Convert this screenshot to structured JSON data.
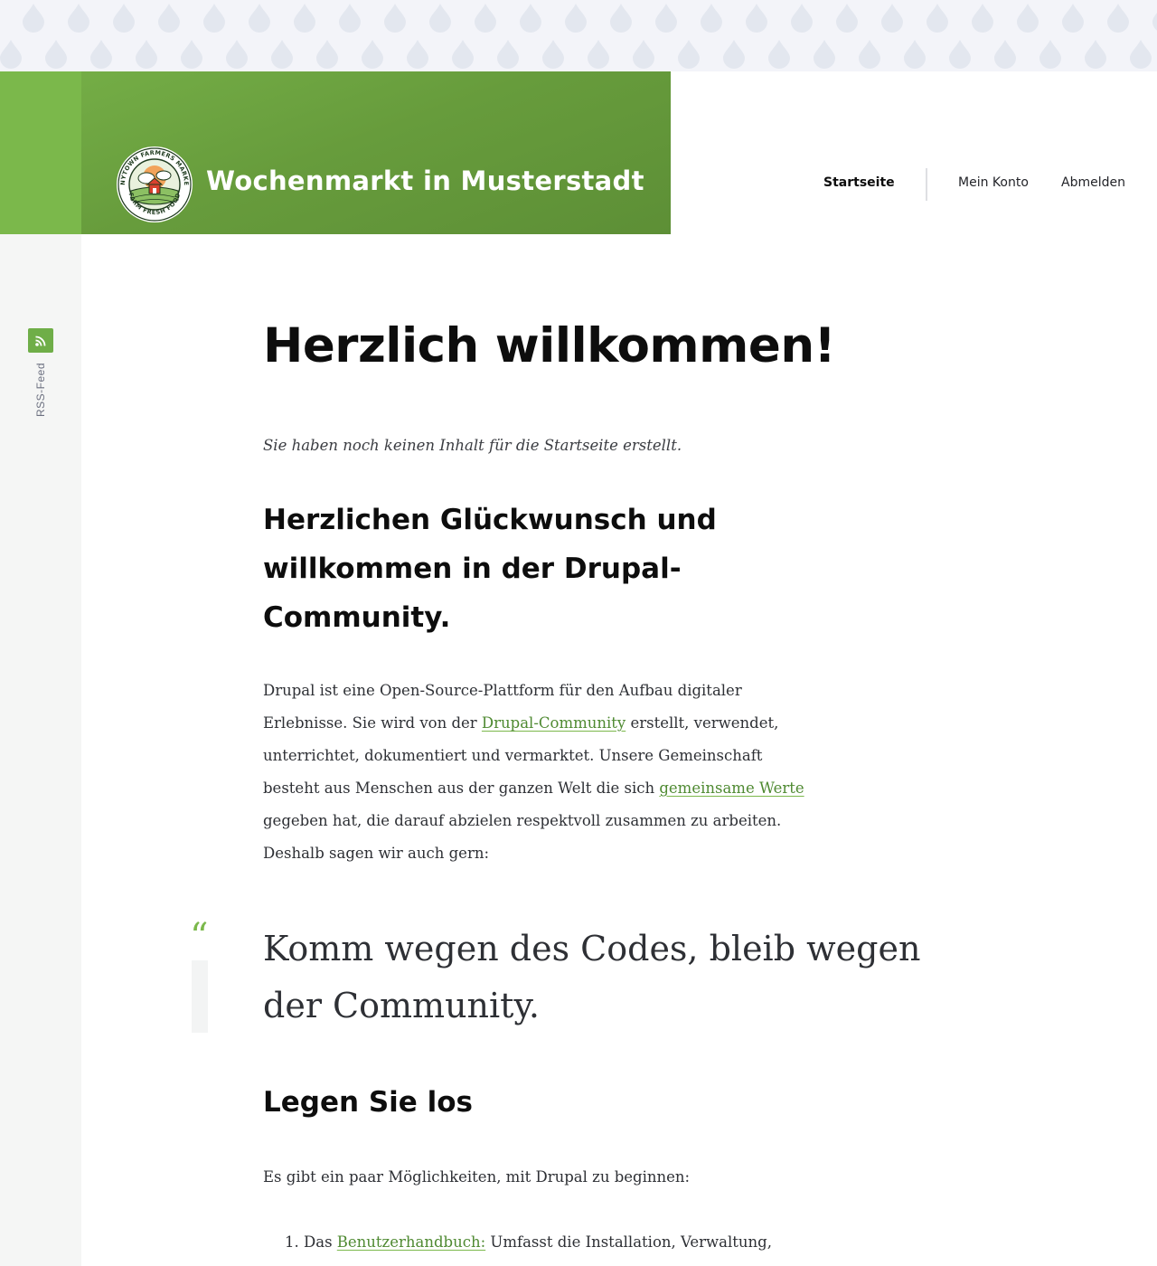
{
  "site": {
    "name": "Wochenmarkt in Musterstadt",
    "logo_name": "anytown-farmers-market-logo",
    "logo_text_top": "ANYTOWN FARMERS MARKET",
    "logo_text_bottom": "FARM FRESH FOOD"
  },
  "nav": {
    "items": [
      {
        "label": "Startseite",
        "active": true
      },
      {
        "label": "Mein Konto",
        "active": false
      },
      {
        "label": "Abmelden",
        "active": false
      }
    ]
  },
  "social": {
    "rss_label": "RSS-Feed",
    "rss_icon": "rss-icon"
  },
  "main": {
    "title": "Herzlich willkommen!",
    "empty_note": "Sie haben noch keinen Inhalt für die Startseite erstellt.",
    "congrats_heading": "Herzlichen Glückwunsch und willkommen in der Drupal-Community.",
    "intro": {
      "part1": "Drupal ist eine Open-Source-Plattform für den Aufbau digitaler Erlebnisse. Sie wird von der ",
      "link1": "Drupal-Community",
      "part2": " erstellt, verwendet, unterrichtet, dokumentiert und vermarktet. Unsere Gemeinschaft besteht aus Menschen aus der ganzen Welt die sich ",
      "link2": "gemeinsame Werte",
      "part3": " gegeben hat, die darauf abzielen respektvoll zusammen zu arbeiten. Deshalb sagen wir auch gern:"
    },
    "quote_mark": "“",
    "quote": "Komm wegen des Codes, bleib wegen der Community.",
    "start_heading": "Legen Sie los",
    "start_intro": "Es gibt ein paar Möglichkeiten, mit Drupal zu beginnen:",
    "steps": [
      {
        "number": "1.",
        "prefix": "Das ",
        "link": "Benutzerhandbuch:",
        "rest": " Umfasst die Installation, Verwaltung,"
      }
    ]
  },
  "colors": {
    "brand_green": "#6fae48",
    "link_green": "#4f8a32",
    "heading": "#0d0d0d",
    "text": "#2e3035"
  }
}
